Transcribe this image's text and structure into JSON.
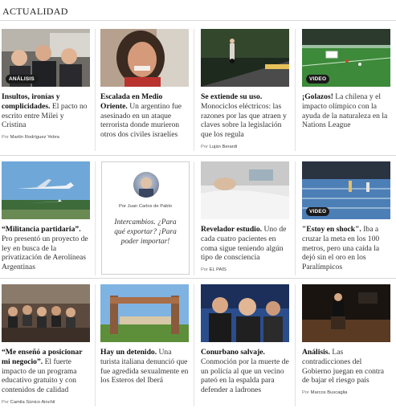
{
  "section": {
    "title": "ACTUALIDAD"
  },
  "rows": [
    {
      "cards": [
        {
          "badge": "ANÁLISIS",
          "title": "Insultos, ironías y complicidades.",
          "body": " El pacto no escrito entre Milei y Cristina",
          "byline_por": "Por",
          "byline_author": "Martín Rodríguez Yebra"
        },
        {
          "badge": "",
          "title": "Escalada en Medio Oriente.",
          "body": " Un argentino fue asesinado en un ataque terrorista donde murieron otros dos civiles israelíes",
          "byline_por": "",
          "byline_author": ""
        },
        {
          "badge": "",
          "title": "Se extiende su uso.",
          "body": " Monociclos eléctricos: las razones por las que atraen y claves sobre la legislación que los regula",
          "byline_por": "Por",
          "byline_author": "Luján Berardi"
        },
        {
          "badge": "VIDEO",
          "title": "¡Golazos!",
          "body": " La chilena y el impacto olímpico con la ayuda de la naturaleza en la Nations League",
          "byline_por": "",
          "byline_author": ""
        }
      ]
    },
    {
      "cards": [
        {
          "badge": "",
          "title": "“Militancia partidaria”.",
          "body": " Pro presentó un proyecto de ley en busca de la privatización de Aerolíneas Argentinas",
          "byline_por": "",
          "byline_author": ""
        },
        {
          "opinion": true,
          "byline_por": "Por",
          "byline_author": "Juan Carlos de Pablo",
          "quote": "Intercambios. ¿Para qué exportar? ¡Para poder importar!"
        },
        {
          "badge": "",
          "title": "Revelador estudio.",
          "body": " Uno de cada cuatro pacientes en coma sigue teniendo algún tipo de consciencia",
          "byline_por": "Por",
          "byline_author": "EL PAÍS"
        },
        {
          "badge": "VIDEO",
          "title": "\"Estoy en shock\".",
          "body": " Iba a cruzar la meta en los 100 metros, pero una caída la dejó sin el oro en los Paralímpicos",
          "byline_por": "",
          "byline_author": ""
        }
      ]
    },
    {
      "cards": [
        {
          "badge": "",
          "title": "“Me enseñó a posicionar mi negocio”.",
          "body": " El fuerte impacto de un programa educativo gratuito y con contenidos de calidad",
          "byline_por": "Por",
          "byline_author": "Camila Súnico Ainchil"
        },
        {
          "badge": "",
          "title": "Hay un detenido.",
          "body": " Una turista italiana denunció que fue agredida sexualmente en los Esteros del Iberá",
          "byline_por": "",
          "byline_author": ""
        },
        {
          "badge": "",
          "title": "Conurbano salvaje.",
          "body": " Conmoción por la muerte de un policía al que un vecino pateó en la espalda para defender a ladrones",
          "byline_por": "",
          "byline_author": ""
        },
        {
          "badge": "",
          "title": "Análisis.",
          "body": " Las contradicciones del Gobierno juegan en contra de bajar el riesgo país",
          "byline_por": "Por",
          "byline_author": "Marcos Buscaglia"
        }
      ]
    }
  ]
}
